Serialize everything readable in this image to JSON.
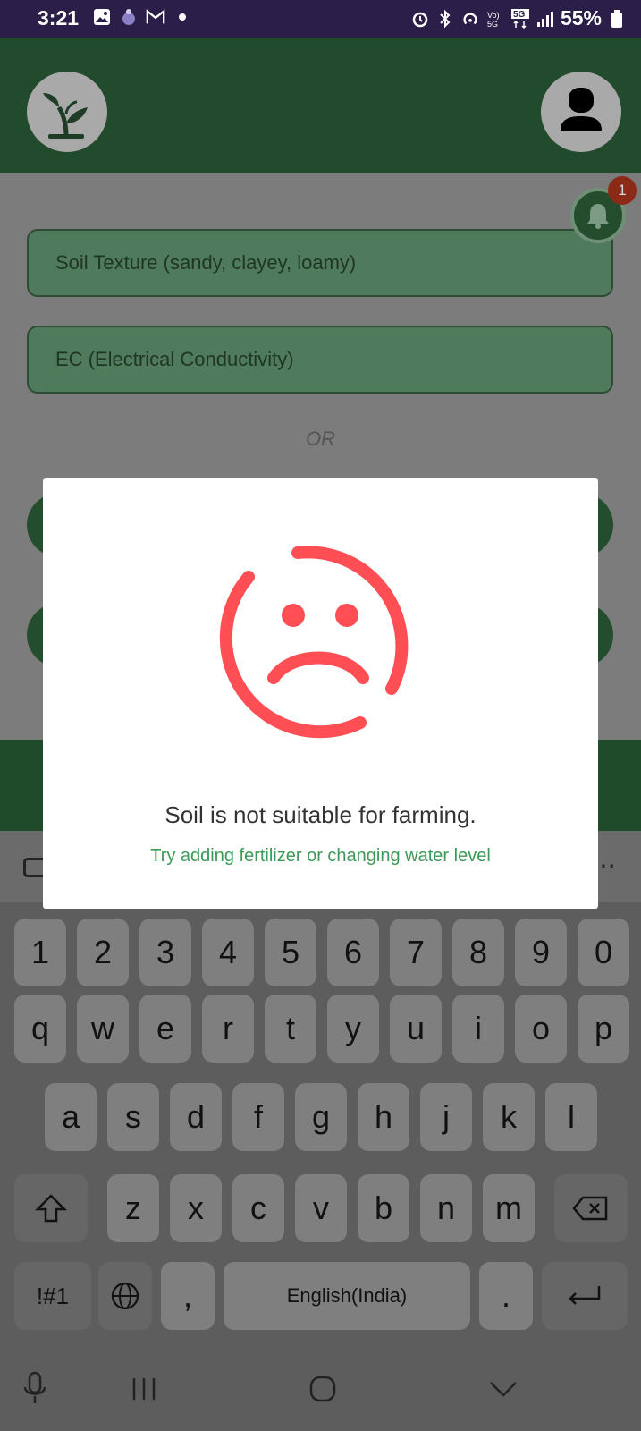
{
  "status_bar": {
    "time": "3:21",
    "battery": "55%",
    "left_icons": [
      "gallery-icon",
      "bug-icon",
      "gmail-icon",
      "dot-icon"
    ],
    "right_icons": [
      "alarm-icon",
      "bluetooth-icon",
      "hotspot-icon",
      "volte-icon",
      "5g-icon",
      "signal-icon",
      "battery-icon"
    ]
  },
  "header": {
    "logo_icon": "plant-sprout-icon",
    "profile_icon": "user-avatar-icon"
  },
  "notifications": {
    "count": "1",
    "icon": "bell-icon"
  },
  "form": {
    "soil_texture_placeholder": "Soil Texture (sandy, clayey, loamy)",
    "ec_placeholder": "EC (Electrical Conductivity)",
    "or_label": "OR"
  },
  "modal": {
    "icon": "sad-face-icon",
    "message": "Soil is not suitable for farming.",
    "suggestion": "Try adding fertilizer or changing water level",
    "accent_color": "#ff4f55",
    "suggestion_color": "#3b9a56"
  },
  "keyboard": {
    "row_numbers": [
      "1",
      "2",
      "3",
      "4",
      "5",
      "6",
      "7",
      "8",
      "9",
      "0"
    ],
    "row_1": [
      "q",
      "w",
      "e",
      "r",
      "t",
      "y",
      "u",
      "i",
      "o",
      "p"
    ],
    "row_2": [
      "a",
      "s",
      "d",
      "f",
      "g",
      "h",
      "j",
      "k",
      "l"
    ],
    "row_3": [
      "z",
      "x",
      "c",
      "v",
      "b",
      "n",
      "m"
    ],
    "symbols_label": "!#1",
    "comma_label": ",",
    "space_label": "English(India)",
    "period_label": "."
  },
  "colors": {
    "header_green": "#214b2c",
    "status_bar": "#2b1f49"
  }
}
